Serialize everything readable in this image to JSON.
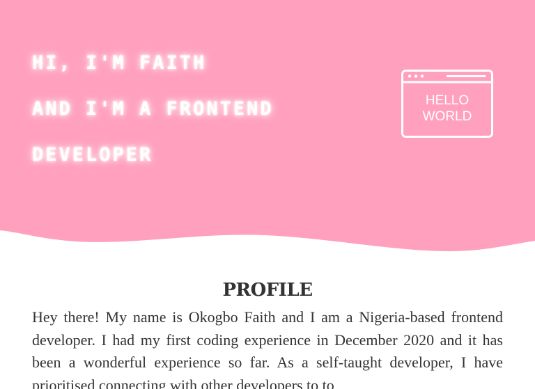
{
  "hero": {
    "lines": [
      "HI, I'M FAITH",
      "AND I'M A FRONTEND",
      "DEVELOPER"
    ],
    "bg_color": "#ffa0be",
    "icon": {
      "name": "browser-window-icon",
      "line1": "HELLO",
      "line2": "WORLD"
    }
  },
  "profile": {
    "title": "PROFILE",
    "body": "Hey there! My name is Okogbo Faith and I am a Nigeria-based frontend developer. I had my first coding experience in December 2020 and it has been a wonderful experience so far. As a self-taught developer, I have prioritised connecting with other developers to to"
  }
}
